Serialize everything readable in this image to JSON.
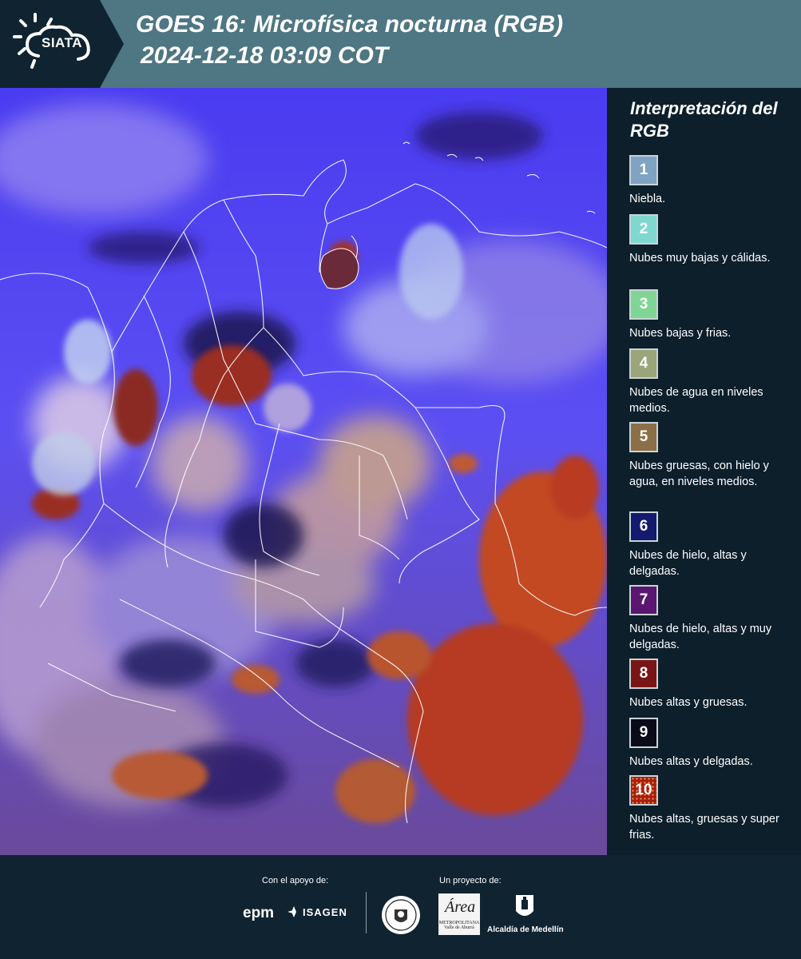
{
  "header": {
    "logo_text": "SIATA",
    "title_line1": "GOES 16: Microfísica nocturna (RGB)",
    "title_line2": "2024-12-18 03:09 COT"
  },
  "legend": {
    "title": "Interpretación del RGB",
    "items": [
      {
        "num": "1",
        "label": "Niebla.",
        "color": "#7fa3c3"
      },
      {
        "num": "2",
        "label": "Nubes muy bajas y cálidas.",
        "color": "#7fd8d0"
      },
      {
        "num": "3",
        "label": "Nubes bajas y frias.",
        "color": "#7fd694"
      },
      {
        "num": "4",
        "label": "Nubes de agua en niveles medios.",
        "color": "#9aa57a"
      },
      {
        "num": "5",
        "label": "Nubes gruesas, con hielo y agua, en niveles medios.",
        "color": "#8c6f47"
      },
      {
        "num": "6",
        "label": "Nubes de hielo, altas y delgadas.",
        "color": "#141a6e"
      },
      {
        "num": "7",
        "label": "Nubes de hielo, altas y muy delgadas.",
        "color": "#5a1670"
      },
      {
        "num": "8",
        "label": "Nubes altas y gruesas.",
        "color": "#7a1515"
      },
      {
        "num": "9",
        "label": "Nubes altas y delgadas.",
        "color": "#0a0a18"
      },
      {
        "num": "10",
        "label": "Nubes altas, gruesas y super frias.",
        "color": "#a81e0c"
      }
    ]
  },
  "footer": {
    "support_label": "Con el apoyo de:",
    "project_label": "Un proyecto de:",
    "sponsor_epm": "epm",
    "sponsor_isagen": "ISAGEN",
    "area_logo_script": "Área",
    "area_logo_text": "METROPOLITANA Valle de Aburrá",
    "medellin_text": "Alcaldía de Medellín"
  }
}
